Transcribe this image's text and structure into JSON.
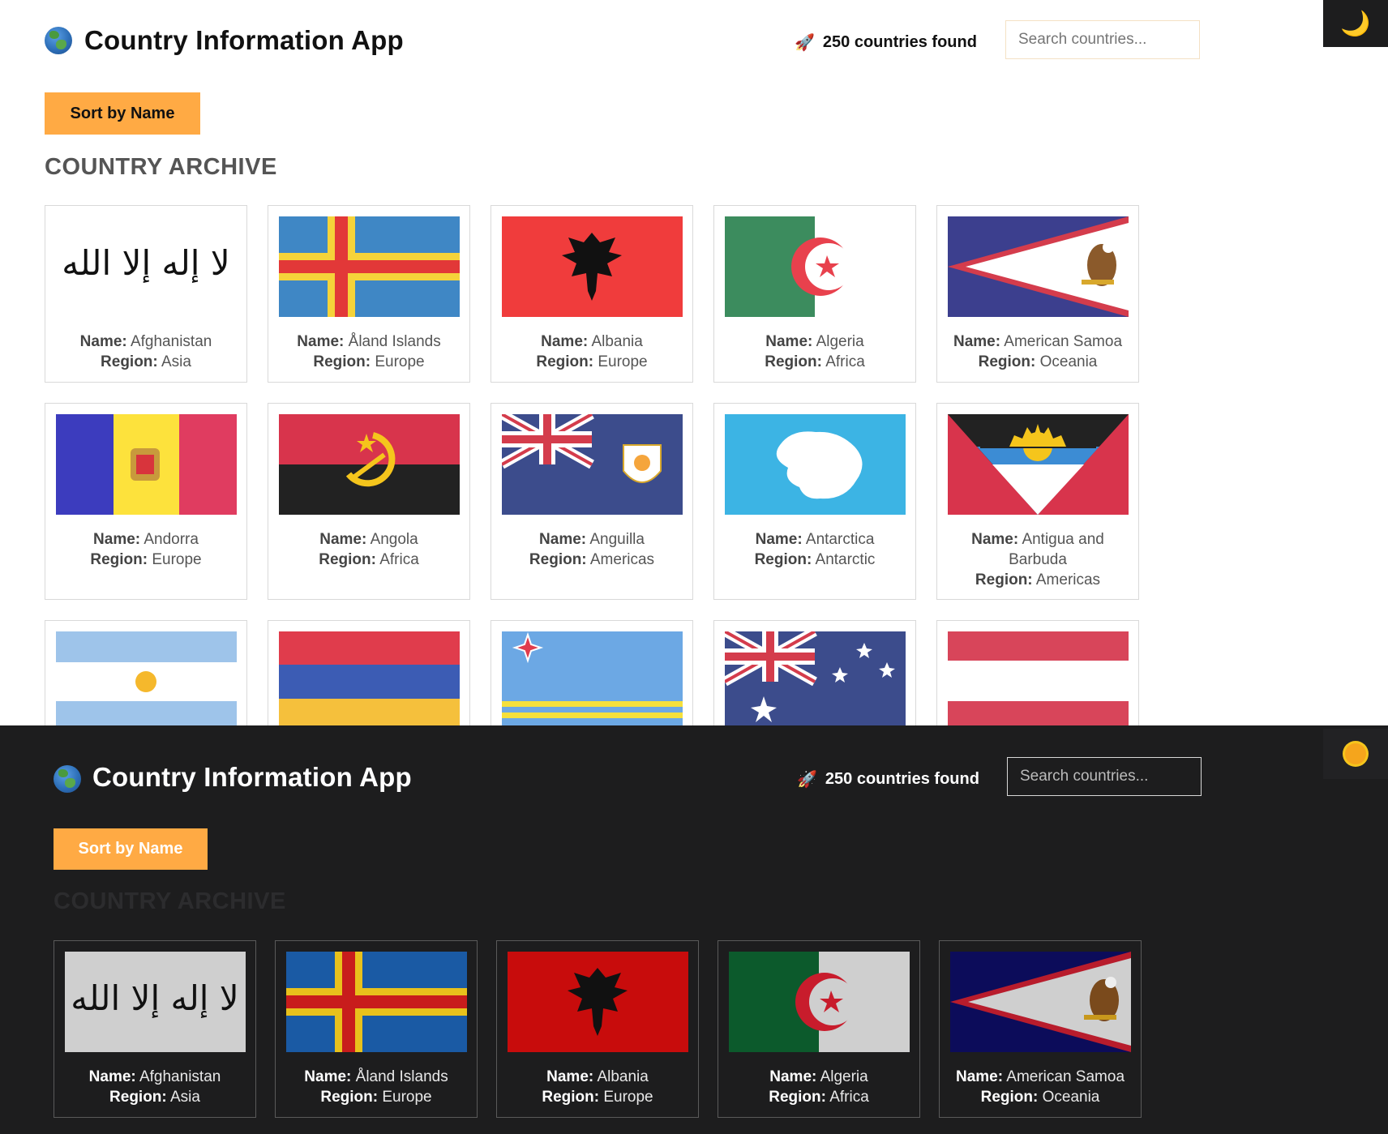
{
  "app": {
    "title": "Country Information App",
    "count_text": "250 countries found",
    "search_placeholder": "Search countries...",
    "sort_label": "Sort by Name",
    "archive_heading": "COUNTRY ARCHIVE",
    "name_label": "Name:",
    "region_label": "Region:",
    "icons": {
      "app": "globe-icon",
      "count": "rocket-icon",
      "light_toggle": "moon-icon",
      "dark_toggle": "sun-icon"
    },
    "colors": {
      "accent": "#ffaa44",
      "dark_bg": "#1d1d1e",
      "light_bg": "#ffffff"
    }
  },
  "light": {
    "countries": [
      {
        "name": "Afghanistan",
        "region": "Asia"
      },
      {
        "name": "Åland Islands",
        "region": "Europe"
      },
      {
        "name": "Albania",
        "region": "Europe"
      },
      {
        "name": "Algeria",
        "region": "Africa"
      },
      {
        "name": "American Samoa",
        "region": "Oceania"
      },
      {
        "name": "Andorra",
        "region": "Europe"
      },
      {
        "name": "Angola",
        "region": "Africa"
      },
      {
        "name": "Anguilla",
        "region": "Americas"
      },
      {
        "name": "Antarctica",
        "region": "Antarctic"
      },
      {
        "name": "Antigua and Barbuda",
        "region": "Americas"
      }
    ]
  },
  "dark": {
    "countries": [
      {
        "name": "Afghanistan",
        "region": "Asia"
      },
      {
        "name": "Åland Islands",
        "region": "Europe"
      },
      {
        "name": "Albania",
        "region": "Europe"
      },
      {
        "name": "Algeria",
        "region": "Africa"
      },
      {
        "name": "American Samoa",
        "region": "Oceania"
      }
    ]
  }
}
